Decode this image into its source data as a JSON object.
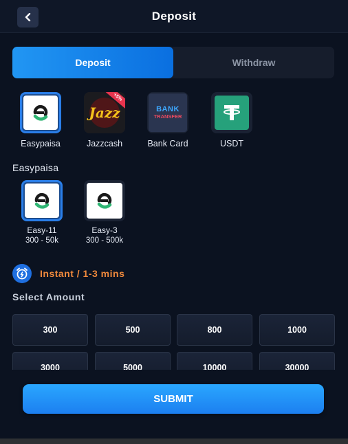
{
  "header": {
    "title": "Deposit",
    "back_icon": "chevron-left-icon"
  },
  "tabs": [
    {
      "label": "Deposit",
      "active": true
    },
    {
      "label": "Withdraw",
      "active": false
    }
  ],
  "methods": [
    {
      "label": "Easypaisa",
      "icon": "easypaisa-logo-icon",
      "selected": true
    },
    {
      "label": "Jazzcash",
      "icon": "jazzcash-logo-icon",
      "selected": false,
      "badge": "+5%"
    },
    {
      "label": "Bank Card",
      "icon": "bank-transfer-logo-icon",
      "selected": false,
      "logo_text": [
        "BANK",
        "TRANSFER"
      ]
    },
    {
      "label": "USDT",
      "icon": "tether-logo-icon",
      "selected": false
    }
  ],
  "section_title": "Easypaisa",
  "channels": [
    {
      "name": "Easy-11",
      "range": "300 - 50k",
      "selected": true
    },
    {
      "name": "Easy-3",
      "range": "300 - 500k",
      "selected": false
    }
  ],
  "speed": {
    "text": "Instant / 1-3 mins",
    "icon": "alarm-clock-icon"
  },
  "amount_title": "Select Amount",
  "amounts": [
    "300",
    "500",
    "800",
    "1000",
    "3000",
    "5000",
    "10000",
    "30000"
  ],
  "submit_label": "SUBMIT",
  "colors": {
    "accent": "#1c7ff0",
    "background": "#0b1220",
    "speed_text": "#f0893c",
    "easypaisa_green": "#2fb573",
    "tether_green": "#26a17b"
  }
}
